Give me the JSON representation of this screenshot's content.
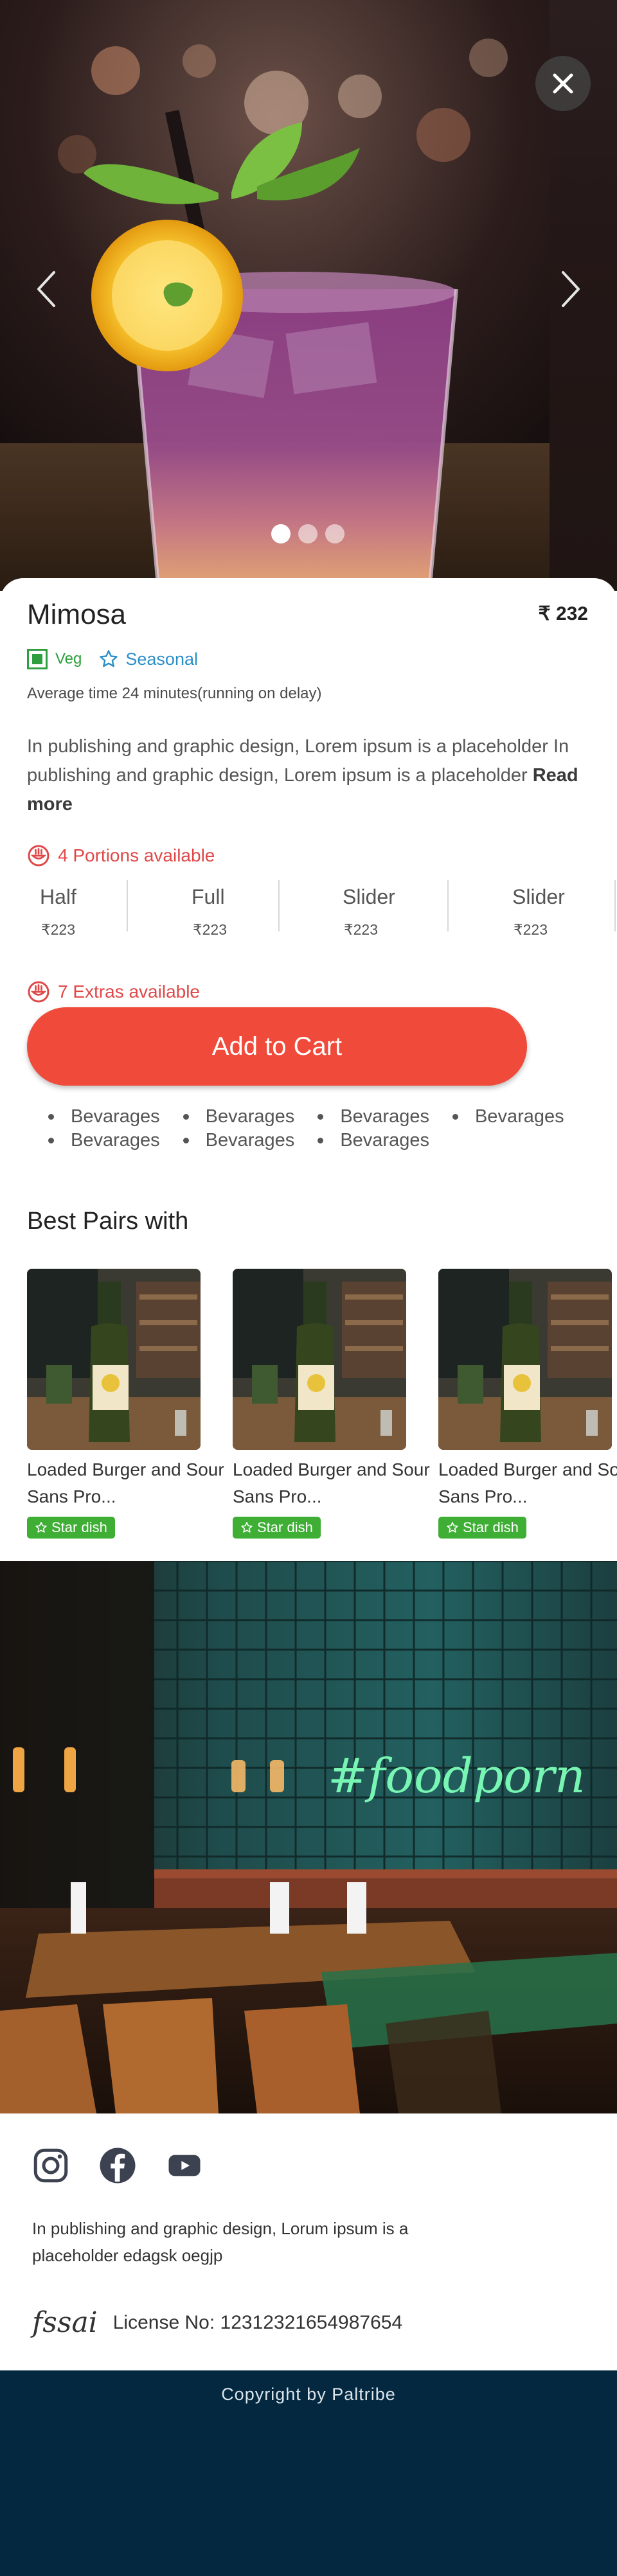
{
  "hero": {
    "close_icon": "close-icon",
    "prev_icon": "chevron-left-icon",
    "next_icon": "chevron-right-icon",
    "slides": 3,
    "active_slide": 1
  },
  "item": {
    "name": "Mimosa",
    "price": "₹ 232",
    "veg_label": "Veg",
    "seasonal_label": "Seasonal",
    "avg_time": "Average time 24 minutes(running on delay)",
    "description": "In publishing and graphic design, Lorem ipsum is a placeholder In publishing and graphic design, Lorem ipsum is a placeholder",
    "read_more": "Read more"
  },
  "portions": {
    "available": "4 Portions available",
    "items": [
      {
        "name": "Half",
        "price": "₹223"
      },
      {
        "name": "Full",
        "price": "₹223"
      },
      {
        "name": "Slider",
        "price": "₹223"
      },
      {
        "name": "Slider",
        "price": "₹223"
      }
    ]
  },
  "extras": {
    "available": "7 Extras available"
  },
  "cart": {
    "label": "Add to Cart"
  },
  "beverages": [
    "Bevarages",
    "Bevarages",
    "Bevarages",
    "Bevarages",
    "Bevarages",
    "Bevarages",
    "Bevarages"
  ],
  "best_pairs": {
    "title": "Best Pairs with",
    "items": [
      {
        "name_line1": "Loaded Burger and Sour",
        "name_line2": "Sans Pro...",
        "badge": "Star dish"
      },
      {
        "name_line1": "Loaded Burger and Sour",
        "name_line2": "Sans Pro...",
        "badge": "Star dish"
      },
      {
        "name_line1": "Loaded Burger and Sour",
        "name_line2": "Sans Pro...",
        "badge": "Star dish"
      }
    ]
  },
  "restaurant_image": {
    "neon_sign": "#foodporn"
  },
  "footer": {
    "socials": [
      "instagram-icon",
      "facebook-icon",
      "youtube-icon"
    ],
    "text": "In publishing and graphic design, Lorum ipsum is a placeholder edagsk oegjp",
    "fssai_logo": "fssai",
    "license": "License No: 12312321654987654",
    "copyright": "Copyright by Paltribe"
  },
  "colors": {
    "accent_red": "#f04a3a",
    "veg_green": "#2e9e3f",
    "seasonal_blue": "#2b8fc7",
    "badge_green": "#3fae35",
    "footer_navy": "#032840"
  }
}
